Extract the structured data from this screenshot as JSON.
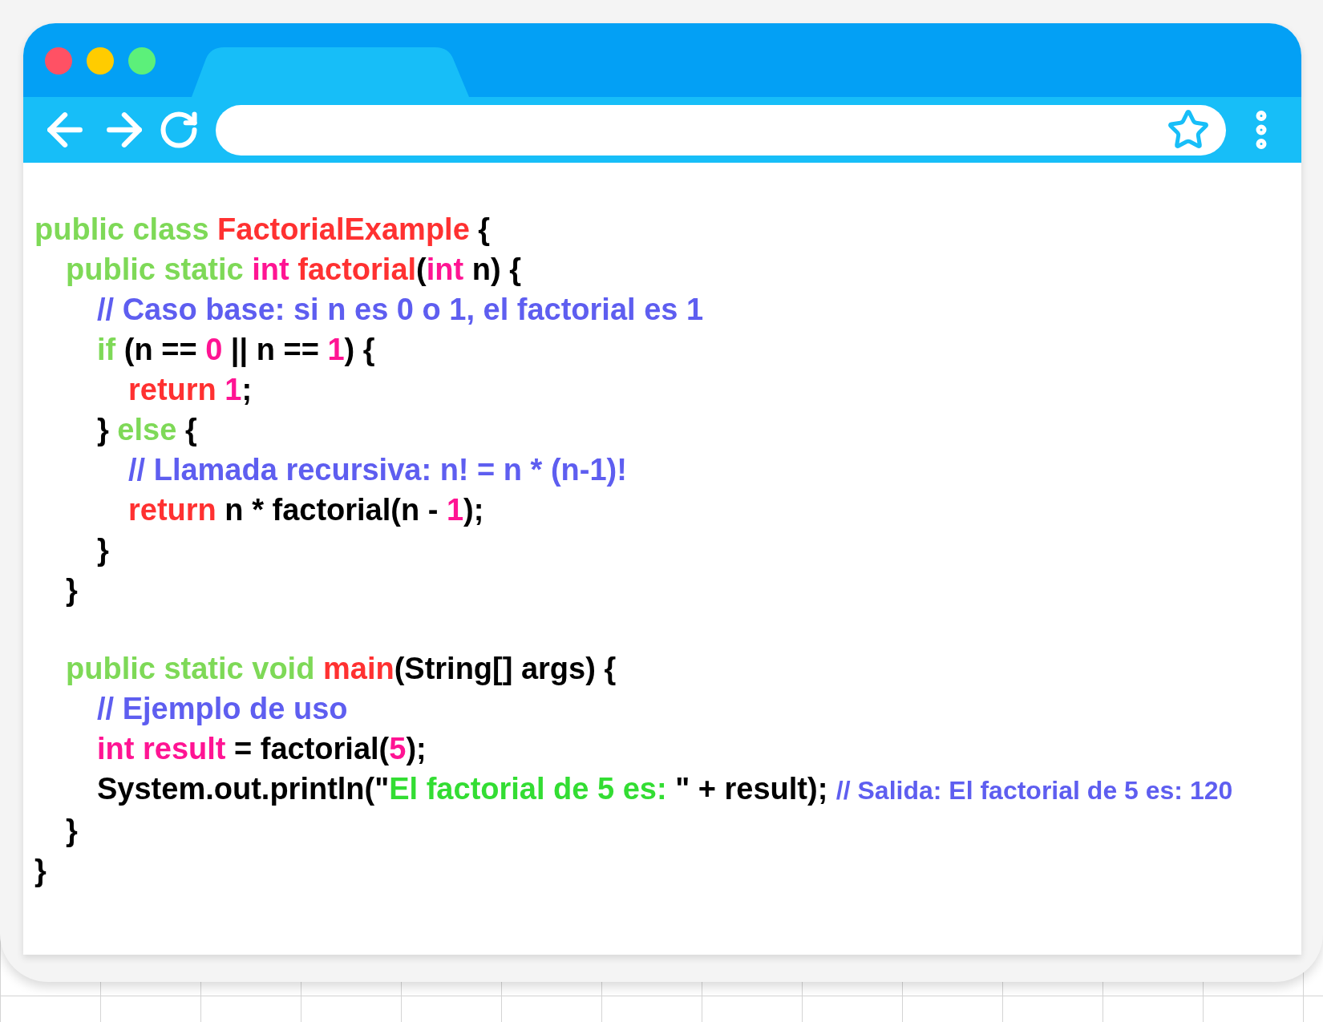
{
  "code": [
    {
      "tokens": [
        {
          "text": "public class ",
          "kind": "keyword"
        },
        {
          "text": "FactorialExample",
          "kind": "name"
        },
        {
          "text": " {",
          "kind": "plain"
        }
      ],
      "members": [
        [
          {
            "tokens": [
              {
                "text": "public static ",
                "kind": "keyword"
              },
              {
                "text": "int ",
                "kind": "type"
              },
              {
                "text": "factorial",
                "kind": "name"
              },
              {
                "text": "(",
                "kind": "plain"
              },
              {
                "text": "int",
                "kind": "type"
              },
              {
                "text": " n) {",
                "kind": "plain"
              }
            ],
            "children": [
              {
                "tokens": [
                  {
                    "text": "// Caso base: si n es 0 o 1, el factorial es 1",
                    "kind": "comment"
                  }
                ]
              },
              {
                "tokens": [
                  {
                    "text": "if ",
                    "kind": "keyword"
                  },
                  {
                    "text": "(n == ",
                    "kind": "plain"
                  },
                  {
                    "text": "0",
                    "kind": "number"
                  },
                  {
                    "text": " || n == ",
                    "kind": "plain"
                  },
                  {
                    "text": "1",
                    "kind": "number"
                  },
                  {
                    "text": ") {",
                    "kind": "plain"
                  }
                ],
                "children": [
                  {
                    "tokens": [
                      {
                        "text": "return ",
                        "kind": "name"
                      },
                      {
                        "text": "1",
                        "kind": "number"
                      },
                      {
                        "text": ";",
                        "kind": "plain"
                      }
                    ]
                  }
                ]
              },
              {
                "tokens": [
                  {
                    "text": "} ",
                    "kind": "plain"
                  },
                  {
                    "text": "else",
                    "kind": "keyword"
                  },
                  {
                    "text": " {",
                    "kind": "plain"
                  }
                ],
                "children": [
                  {
                    "tokens": [
                      {
                        "text": "// Llamada recursiva: n! = n * (n-1)!",
                        "kind": "comment"
                      }
                    ]
                  },
                  {
                    "tokens": [
                      {
                        "text": "return ",
                        "kind": "name"
                      },
                      {
                        "text": "n * factorial(n - ",
                        "kind": "plain"
                      },
                      {
                        "text": "1",
                        "kind": "number"
                      },
                      {
                        "text": ");",
                        "kind": "plain"
                      }
                    ]
                  }
                ]
              },
              {
                "tokens": [
                  {
                    "text": "}",
                    "kind": "plain"
                  }
                ]
              }
            ]
          },
          {
            "tokens": [
              {
                "text": "}",
                "kind": "plain"
              }
            ]
          }
        ],
        [
          {
            "tokens": [
              {
                "text": "public static void ",
                "kind": "keyword"
              },
              {
                "text": "main",
                "kind": "name"
              },
              {
                "text": "(String[] args) {",
                "kind": "plain"
              }
            ],
            "children": [
              {
                "tokens": [
                  {
                    "text": "// Ejemplo de uso",
                    "kind": "comment"
                  }
                ]
              },
              {
                "tokens": [
                  {
                    "text": "int result",
                    "kind": "type"
                  },
                  {
                    "text": " = factorial(",
                    "kind": "plain"
                  },
                  {
                    "text": "5",
                    "kind": "number"
                  },
                  {
                    "text": ");",
                    "kind": "plain"
                  }
                ]
              },
              {
                "tokens": [
                  {
                    "text": "System.out.println(\"",
                    "kind": "plain"
                  },
                  {
                    "text": "El factorial de 5 es: ",
                    "kind": "string"
                  },
                  {
                    "text": "\" + result); ",
                    "kind": "plain"
                  },
                  {
                    "text": "// Salida: El factorial de 5 es: 120",
                    "kind": "note"
                  }
                ]
              }
            ]
          },
          {
            "tokens": [
              {
                "text": "}",
                "kind": "plain"
              }
            ]
          }
        ]
      ]
    },
    {
      "tokens": [
        {
          "text": "}",
          "kind": "plain"
        }
      ]
    }
  ]
}
